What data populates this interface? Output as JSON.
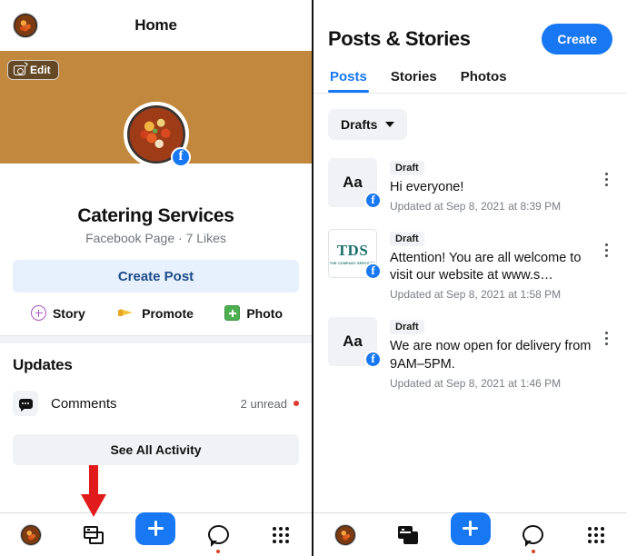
{
  "left": {
    "header": {
      "title": "Home",
      "avatar_icon": "page-avatar-food-bowl"
    },
    "cover": {
      "edit_label": "Edit",
      "camera_icon": "camera-icon"
    },
    "profile": {
      "badge": "f",
      "name": "Catering Services",
      "subtitle": "Facebook Page · 7 Likes"
    },
    "create_post_label": "Create Post",
    "quick_actions": [
      {
        "label": "Story",
        "icon": "circle-plus-icon"
      },
      {
        "label": "Promote",
        "icon": "megaphone-icon"
      },
      {
        "label": "Photo",
        "icon": "photo-plus-icon"
      }
    ],
    "updates": {
      "heading": "Updates",
      "comments_label": "Comments",
      "comments_icon": "comment-bubble-icon",
      "unread_text": "2 unread",
      "see_all_label": "See All Activity"
    },
    "bottom_nav": [
      {
        "name": "avatar",
        "icon": "page-avatar-food-bowl",
        "active": false
      },
      {
        "name": "pages",
        "icon": "pages-icon",
        "active": false
      },
      {
        "name": "create",
        "icon": "plus-icon",
        "active": false
      },
      {
        "name": "chat",
        "icon": "chat-bubble-icon",
        "active": false,
        "badge": true
      },
      {
        "name": "menu",
        "icon": "grid-menu-icon",
        "active": false
      }
    ],
    "annotation": {
      "type": "red-down-arrow",
      "points_to": "pages-icon"
    }
  },
  "right": {
    "title": "Posts & Stories",
    "create_label": "Create",
    "tabs": [
      {
        "label": "Posts",
        "active": true
      },
      {
        "label": "Stories",
        "active": false
      },
      {
        "label": "Photos",
        "active": false
      }
    ],
    "filter": {
      "label": "Drafts",
      "caret_icon": "chevron-down-icon"
    },
    "drafts": [
      {
        "thumb_type": "text",
        "thumb_label": "Aa",
        "badge": "Draft",
        "text": "Hi everyone!",
        "meta": "Updated at Sep 8, 2021 at 8:39 PM",
        "fb_badge": "f"
      },
      {
        "thumb_type": "logo",
        "thumb_label": "TDS",
        "thumb_sublabel": "THE COMPANY SERVICES",
        "badge": "Draft",
        "text": "Attention! You are all welcome to visit our website at www.s…",
        "meta": "Updated at Sep 8, 2021 at 1:58 PM",
        "fb_badge": "f"
      },
      {
        "thumb_type": "text",
        "thumb_label": "Aa",
        "badge": "Draft",
        "text": "We are now open for delivery from 9AM–5PM.",
        "meta": "Updated at Sep 8, 2021 at 1:46 PM",
        "fb_badge": "f"
      }
    ],
    "bottom_nav": [
      {
        "name": "avatar",
        "icon": "page-avatar-food-bowl",
        "active": false
      },
      {
        "name": "pages",
        "icon": "pages-icon",
        "active": true
      },
      {
        "name": "create",
        "icon": "plus-icon",
        "active": false
      },
      {
        "name": "chat",
        "icon": "chat-bubble-icon",
        "active": false,
        "badge": true
      },
      {
        "name": "menu",
        "icon": "grid-menu-icon",
        "active": false
      }
    ]
  },
  "colors": {
    "fb_blue": "#1877f2",
    "create_post_bg": "#e7f0fd",
    "create_post_text": "#1b4a8a",
    "chip_bg": "#f0f2f5",
    "unread_dot": "#e0392b",
    "annotation_red": "#e11b1b",
    "tds_teal": "#1d6f6b"
  }
}
